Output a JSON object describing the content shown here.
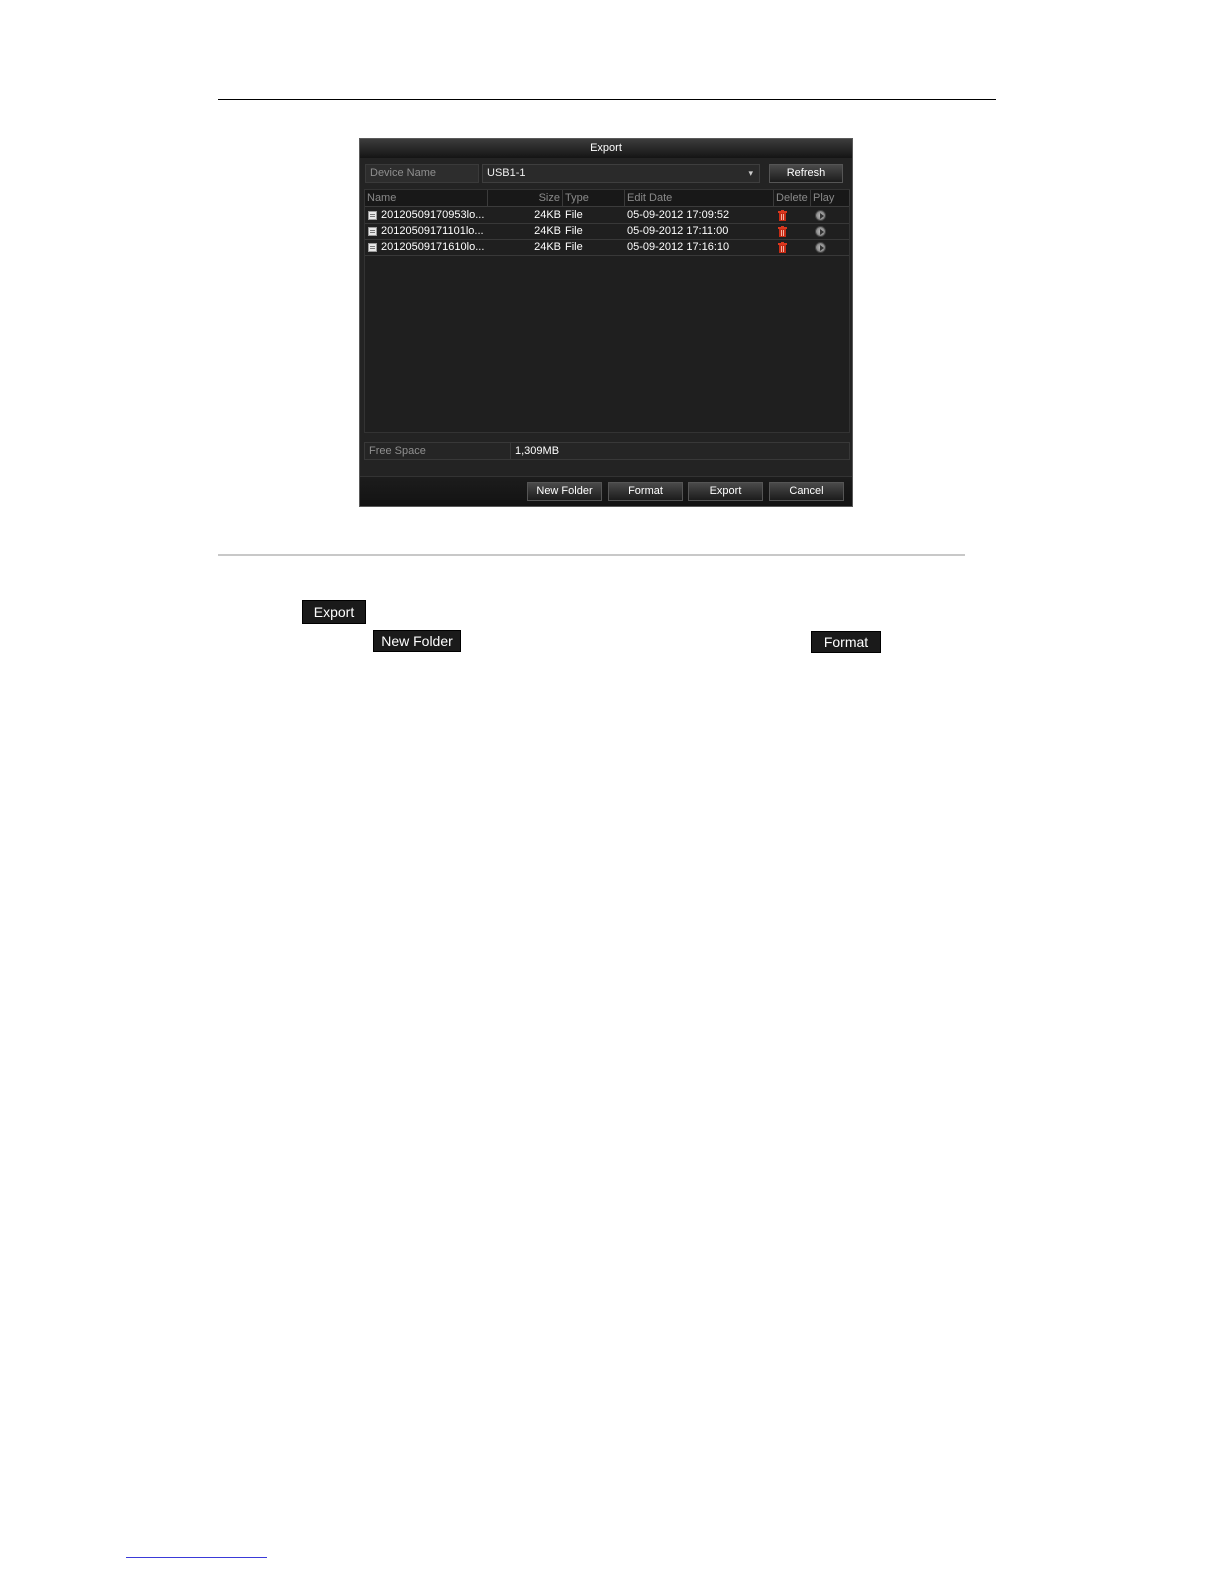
{
  "dialog": {
    "title": "Export",
    "device_label": "Device Name",
    "device_value": "USB1-1",
    "refresh_label": "Refresh",
    "columns": [
      "Name",
      "Size",
      "Type",
      "Edit Date",
      "Delete",
      "Play"
    ],
    "rows": [
      {
        "name": "20120509170953lo...",
        "size": "24KB",
        "type": "File",
        "date": "05-09-2012 17:09:52"
      },
      {
        "name": "20120509171101lo...",
        "size": "24KB",
        "type": "File",
        "date": "05-09-2012 17:11:00"
      },
      {
        "name": "20120509171610lo...",
        "size": "24KB",
        "type": "File",
        "date": "05-09-2012 17:16:10"
      }
    ],
    "free_space_label": "Free Space",
    "free_space_value": "1,309MB",
    "buttons": {
      "new_folder": "New Folder",
      "format": "Format",
      "export": "Export",
      "cancel": "Cancel"
    }
  },
  "inline_buttons": {
    "export": "Export",
    "new_folder": "New Folder",
    "format": "Format"
  },
  "colors": {
    "dialog_bg": "#232323",
    "delete_icon": "#d9381e"
  }
}
